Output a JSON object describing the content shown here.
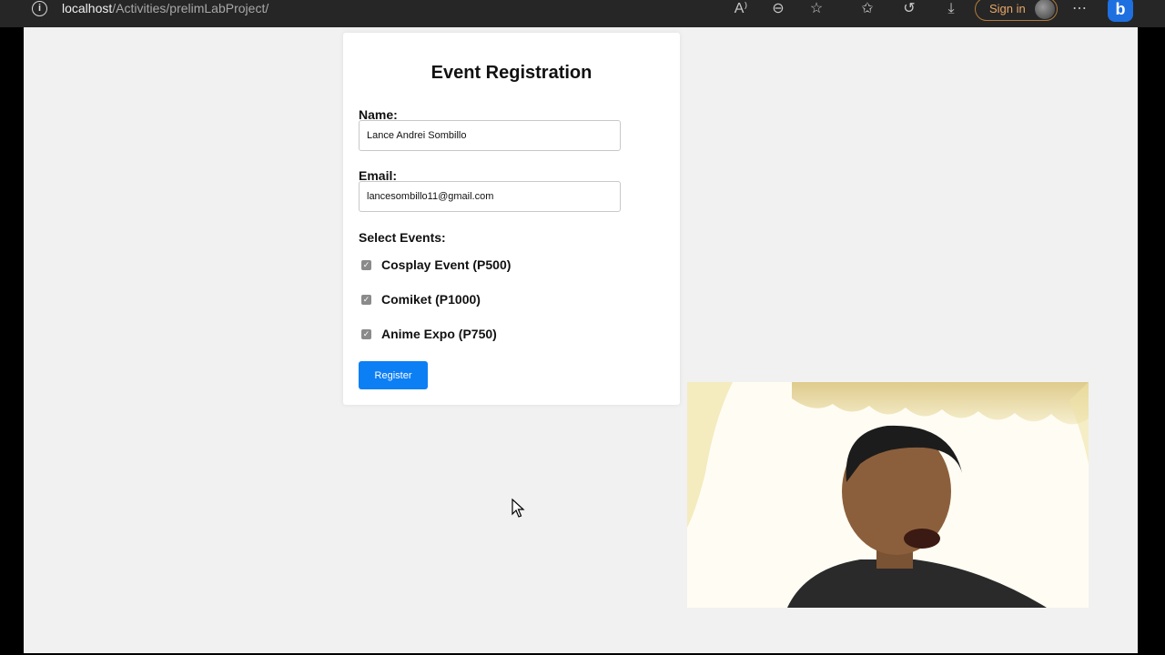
{
  "browser": {
    "url_host": "localhost",
    "url_path": "/Activities/prelimLabProject/",
    "sign_in_label": "Sign in",
    "toolbar_icons": [
      "read-aloud-icon",
      "zoom-out-icon",
      "favorite-star-icon",
      "favorites-list-icon",
      "history-icon",
      "download-icon",
      "more-options-icon",
      "bing-copilot-icon"
    ]
  },
  "form": {
    "title": "Event Registration",
    "name_label": "Name:",
    "name_value": "Lance Andrei Sombillo",
    "email_label": "Email:",
    "email_value": "lancesombillo11@gmail.com",
    "events_label": "Select Events:",
    "events": [
      {
        "label": "Cosplay Event (P500)",
        "checked": true
      },
      {
        "label": "Comiket (P1000)",
        "checked": true
      },
      {
        "label": "Anime Expo (P750)",
        "checked": true
      }
    ],
    "submit_label": "Register"
  },
  "colors": {
    "button": "#0d7ff5",
    "page_bg": "#f1f1f1",
    "toolbar_bg": "#262626",
    "sign_in_accent": "#e8a868"
  }
}
